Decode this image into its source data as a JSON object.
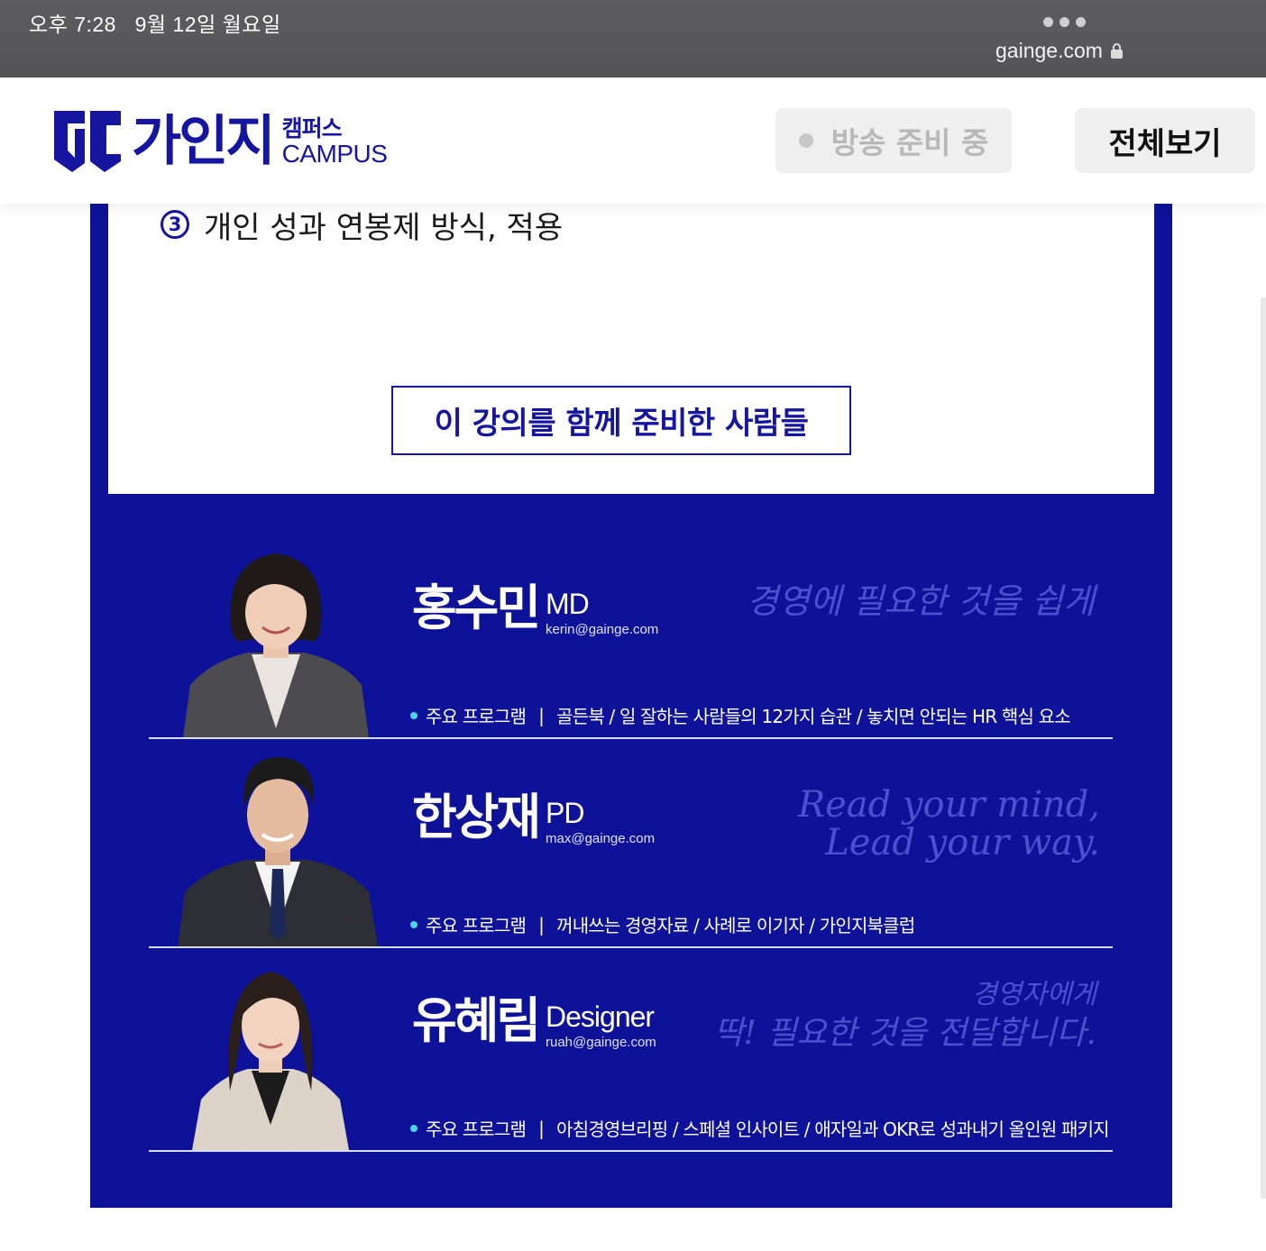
{
  "status_bar": {
    "time_date": "오후 7:28   9월 12일 월요일",
    "url": "gainge.com"
  },
  "header": {
    "logo_name": "가인지",
    "logo_sub_ko": "캠퍼스",
    "logo_sub_en": "CAMPUS",
    "live_label": "방송 준비 중",
    "view_all_label": "전체보기"
  },
  "content": {
    "item3_number": "3",
    "item3_text": "개인 성과 연봉제 방식, 적용",
    "section_title": "이 강의를 함께 준비한 사람들",
    "program_label": "주요 프로그램",
    "separator": "|",
    "people": [
      {
        "name": "홍수민",
        "role": "MD",
        "email": "kerin@gainge.com",
        "programs": "골든북 / 일 잘하는 사람들의 12가지 습관 / 놓치면 안되는 HR 핵심 요소",
        "slogan_lines": [
          "경영에 필요한 것을 쉽게"
        ]
      },
      {
        "name": "한상재",
        "role": "PD",
        "email": "max@gainge.com",
        "programs": "꺼내쓰는 경영자료 / 사례로 이기자 / 가인지북클럽",
        "slogan_lines": [
          "Read your mind,",
          "Lead your way."
        ]
      },
      {
        "name": "유혜림",
        "role": "Designer",
        "email": "ruah@gainge.com",
        "programs": "아침경영브리핑 / 스페셜 인사이트 / 애자일과 OKR로 성과내기 올인원 패키지",
        "slogan_lines": [
          "경영자에게",
          "딱! 필요한 것을 전달합니다."
        ]
      }
    ]
  },
  "colors": {
    "brand_navy": "#0e1299",
    "logo_blue": "#1615a0",
    "bullet_cyan": "#4fd3ea"
  }
}
